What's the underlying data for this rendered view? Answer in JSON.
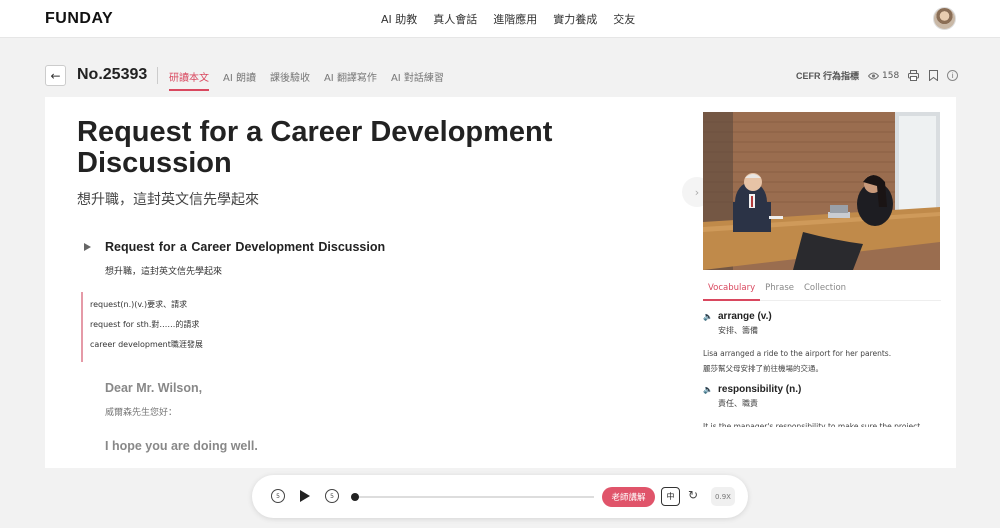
{
  "brand": {
    "logo": "FUNDAY"
  },
  "nav": {
    "items": [
      "AI 助教",
      "真人會話",
      "進階應用",
      "實力養成",
      "交友"
    ]
  },
  "subheader": {
    "back_icon": "arrow-left-icon",
    "article_no": "No.25393",
    "tabs": [
      {
        "label": "研讀本文",
        "active": true
      },
      {
        "label": "AI 朗讀",
        "active": false
      },
      {
        "label": "課後驗收",
        "active": false
      },
      {
        "label": "AI 翻譯寫作",
        "active": false
      },
      {
        "label": "AI 對話練習",
        "active": false
      }
    ],
    "cefr_label": "CEFR 行為指標",
    "views": "158"
  },
  "article": {
    "title": "Request for a Career Development Discussion",
    "subtitle": "想升職，這封英文信先學起來",
    "paragraph_title": "Request for a Career Development Discussion",
    "paragraph_sub": "想升職，這封英文信先學起來",
    "notes": [
      "request(n.)(v.)要求、請求",
      "request for sth.對……的請求",
      "career development職涯發展"
    ],
    "greeting": "Dear Mr. Wilson,",
    "greeting_zh": "威爾森先生您好：",
    "line1": "I hope you are doing well."
  },
  "panel": {
    "tabs": [
      {
        "label": "Vocabulary",
        "active": true
      },
      {
        "label": "Phrase",
        "active": false
      },
      {
        "label": "Collection",
        "active": false
      }
    ],
    "vocab": [
      {
        "word": "arrange (v.)",
        "meaning": "安排、籌備",
        "example_en": "Lisa arranged a ride to the airport for her parents.",
        "example_zh": "麗莎幫父母安排了前往機場的交通。"
      },
      {
        "word": "responsibility (n.)",
        "meaning": "責任、職責",
        "example_en": "It is the manager's responsibility to make sure the project",
        "example_zh": ""
      }
    ]
  },
  "player": {
    "rewind_label": "5",
    "forward_label": "5",
    "progress": 0.0,
    "teacher_label": "老師講解",
    "zh_label": "中",
    "speed_label": "0.9X"
  },
  "colors": {
    "accent": "#d9485f"
  }
}
